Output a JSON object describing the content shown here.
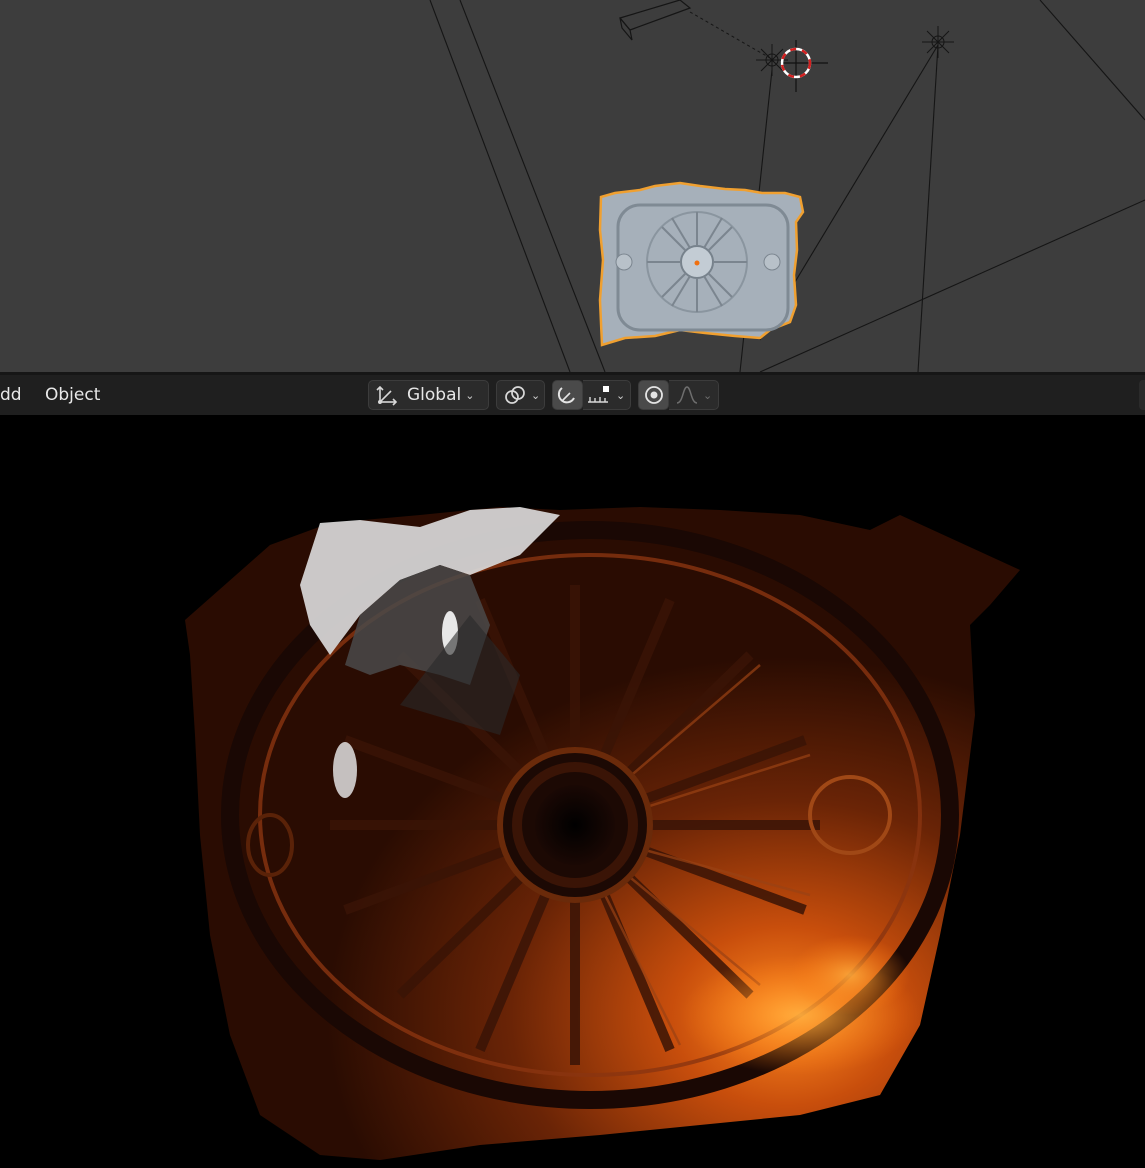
{
  "header": {
    "menu_add": "dd",
    "menu_object": "Object",
    "transform_orientation": "Global",
    "icons": [
      "transform-axes-icon",
      "pivot-link-icon",
      "snap-magnet-icon",
      "snap-increment-icon",
      "proportional-edit-icon",
      "falloff-curve-icon"
    ]
  },
  "colors": {
    "viewport_bg": "#3d3d3d",
    "header_bg": "#1f1f1f",
    "selection_outline": "#f0a030",
    "render_glow": "#ff7a10"
  }
}
